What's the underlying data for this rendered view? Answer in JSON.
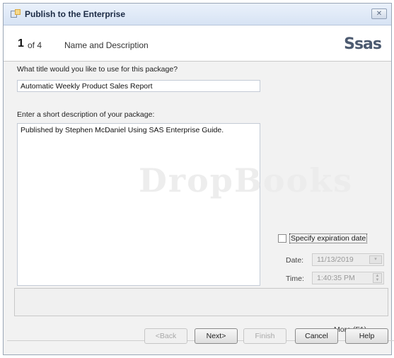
{
  "window": {
    "title": "Publish to the Enterprise",
    "close_label": "✕"
  },
  "header": {
    "step_number": "1",
    "step_of": "of 4",
    "step_name": "Name and Description",
    "logo": "Ssas"
  },
  "form": {
    "title_label": "What title would you like to use for this package?",
    "title_value": "Automatic Weekly Product Sales Report",
    "desc_label": "Enter a short description of your package:",
    "desc_value": "Published by Stephen McDaniel Using SAS Enterprise Guide."
  },
  "expiration": {
    "checkbox_label": "Specify expiration date",
    "checked": false,
    "date_label": "Date:",
    "date_value": "11/13/2019",
    "time_label": "Time:",
    "time_value": "1:40:35 PM"
  },
  "watermark": "DropBooks",
  "more_label": "More (F1)...",
  "buttons": {
    "back": "<Back",
    "next": "Next>",
    "finish": "Finish",
    "cancel": "Cancel",
    "help": "Help"
  }
}
